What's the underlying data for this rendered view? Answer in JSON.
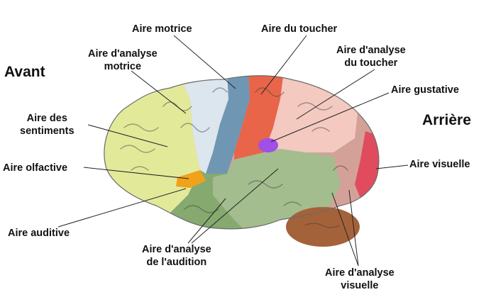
{
  "orientation": {
    "front": "Avant",
    "back": "Arrière"
  },
  "labels": {
    "motor": "Aire motrice",
    "motor_analysis": [
      "Aire d'analyse",
      "motrice"
    ],
    "touch": "Aire du toucher",
    "touch_analysis": [
      "Aire d'analyse",
      "du toucher"
    ],
    "taste": "Aire gustative",
    "feelings": [
      "Aire des",
      "sentiments"
    ],
    "smell": "Aire olfactive",
    "hearing": "Aire auditive",
    "hearing_analysis": [
      "Aire d'analyse",
      "de l'audition"
    ],
    "visual": "Aire visuelle",
    "visual_analysis": [
      "Aire d'analyse",
      "visuelle"
    ]
  },
  "colors": {
    "feelings": "#e2ea9a",
    "motor_analysis": "#dce6ef",
    "motor": "#6f97b3",
    "touch": "#e8654a",
    "touch_analysis": "#f3c9c0",
    "hearing": "#86a96f",
    "hearing_analysis": "#a3bd8e",
    "smell": "#f0a21a",
    "taste": "#a24ee8",
    "visual_analysis": "#d4a199",
    "visual": "#e04c5e",
    "cerebellum": "#a4623a",
    "leader_line": "#222222"
  }
}
